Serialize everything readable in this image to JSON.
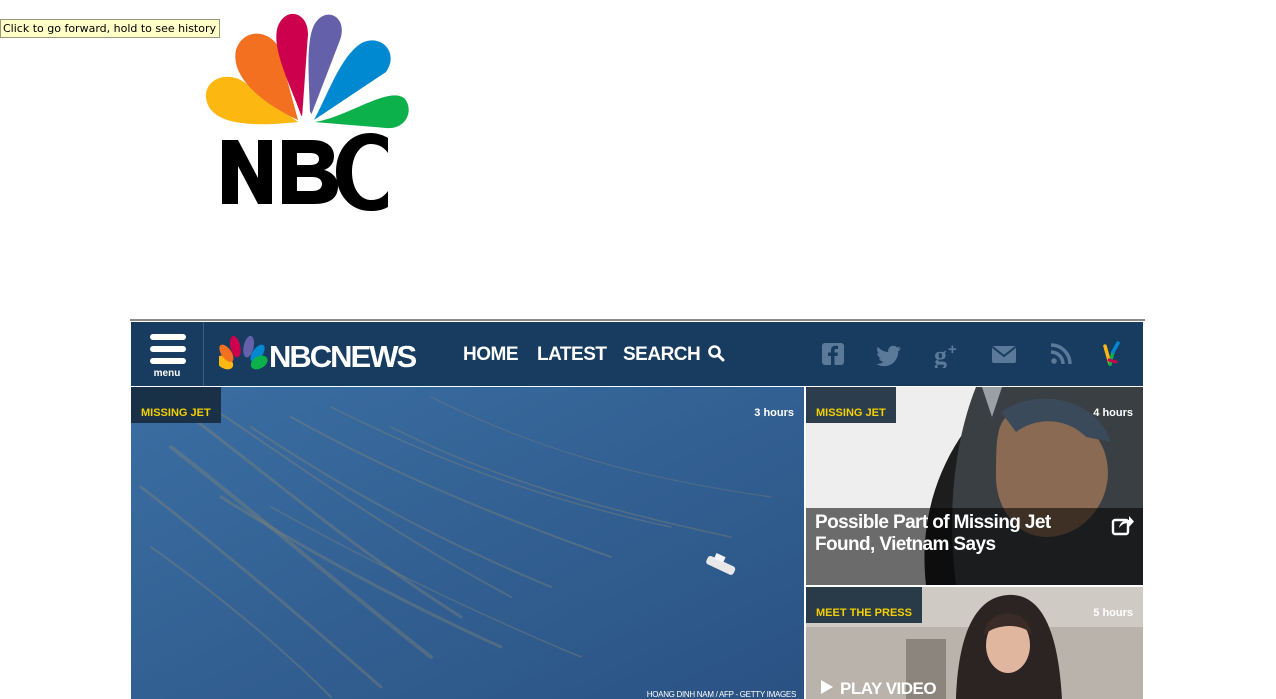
{
  "tooltip": "Click to go forward, hold to see history",
  "nav": {
    "menu_label": "menu",
    "logo_text": "NBCNEWS",
    "links": [
      "HOME",
      "LATEST",
      "SEARCH"
    ]
  },
  "tiles": {
    "main": {
      "tag": "MISSING JET",
      "time": "3 hours",
      "credit": "HOANG DINH NAM / AFP - GETTY IMAGES"
    },
    "side1": {
      "tag": "MISSING JET",
      "time": "4 hours",
      "headline": "Possible Part of Missing Jet Found, Vietnam Says"
    },
    "side2": {
      "tag": "MEET THE PRESS",
      "time": "5 hours",
      "play_label": "PLAY VIDEO"
    }
  },
  "colors": {
    "nav_bg": "#173c5f",
    "tag_yellow": "#f4d000",
    "ocean": "#2f5a8c"
  }
}
